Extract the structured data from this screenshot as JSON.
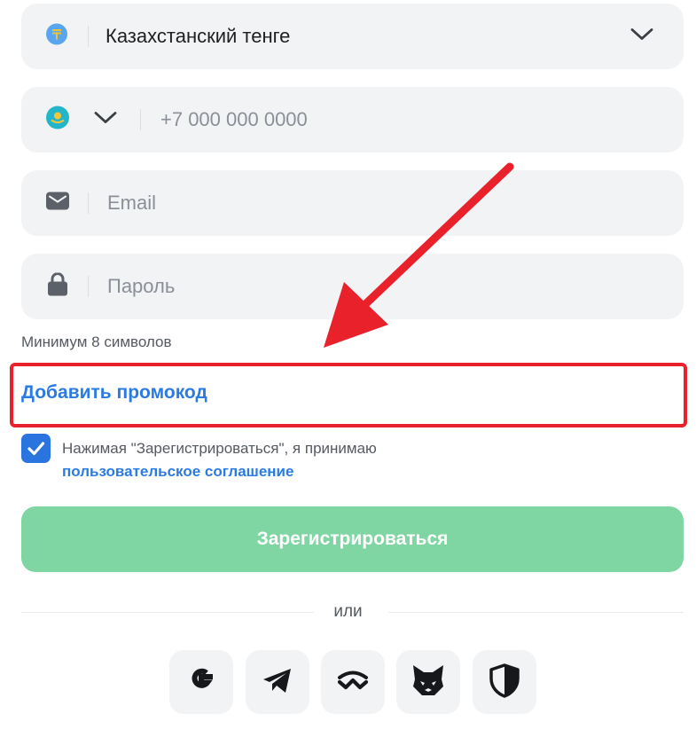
{
  "currency": {
    "value": "Казахстанский тенге",
    "icon": "tenge-coin-icon"
  },
  "phone": {
    "placeholder": "+7 000 000 0000",
    "icon": "kazakhstan-flag-icon"
  },
  "email": {
    "placeholder": "Email",
    "icon": "envelope-icon"
  },
  "password": {
    "placeholder": "Пароль",
    "icon": "lock-icon",
    "hint": "Минимум 8 символов"
  },
  "promo": {
    "label": "Добавить промокод"
  },
  "terms": {
    "checked": true,
    "text": "Нажимая \"Зарегистрироваться\", я принимаю",
    "link": "пользовательское соглашение"
  },
  "register": {
    "label": "Зарегистрироваться"
  },
  "divider": {
    "label": "или"
  },
  "social": [
    "google-icon",
    "telegram-icon",
    "walletconnect-icon",
    "metamask-icon",
    "shield-icon"
  ],
  "colors": {
    "accent_blue": "#2a7be4",
    "button_green": "#7fd6a3",
    "highlight_red": "#e8212a"
  }
}
